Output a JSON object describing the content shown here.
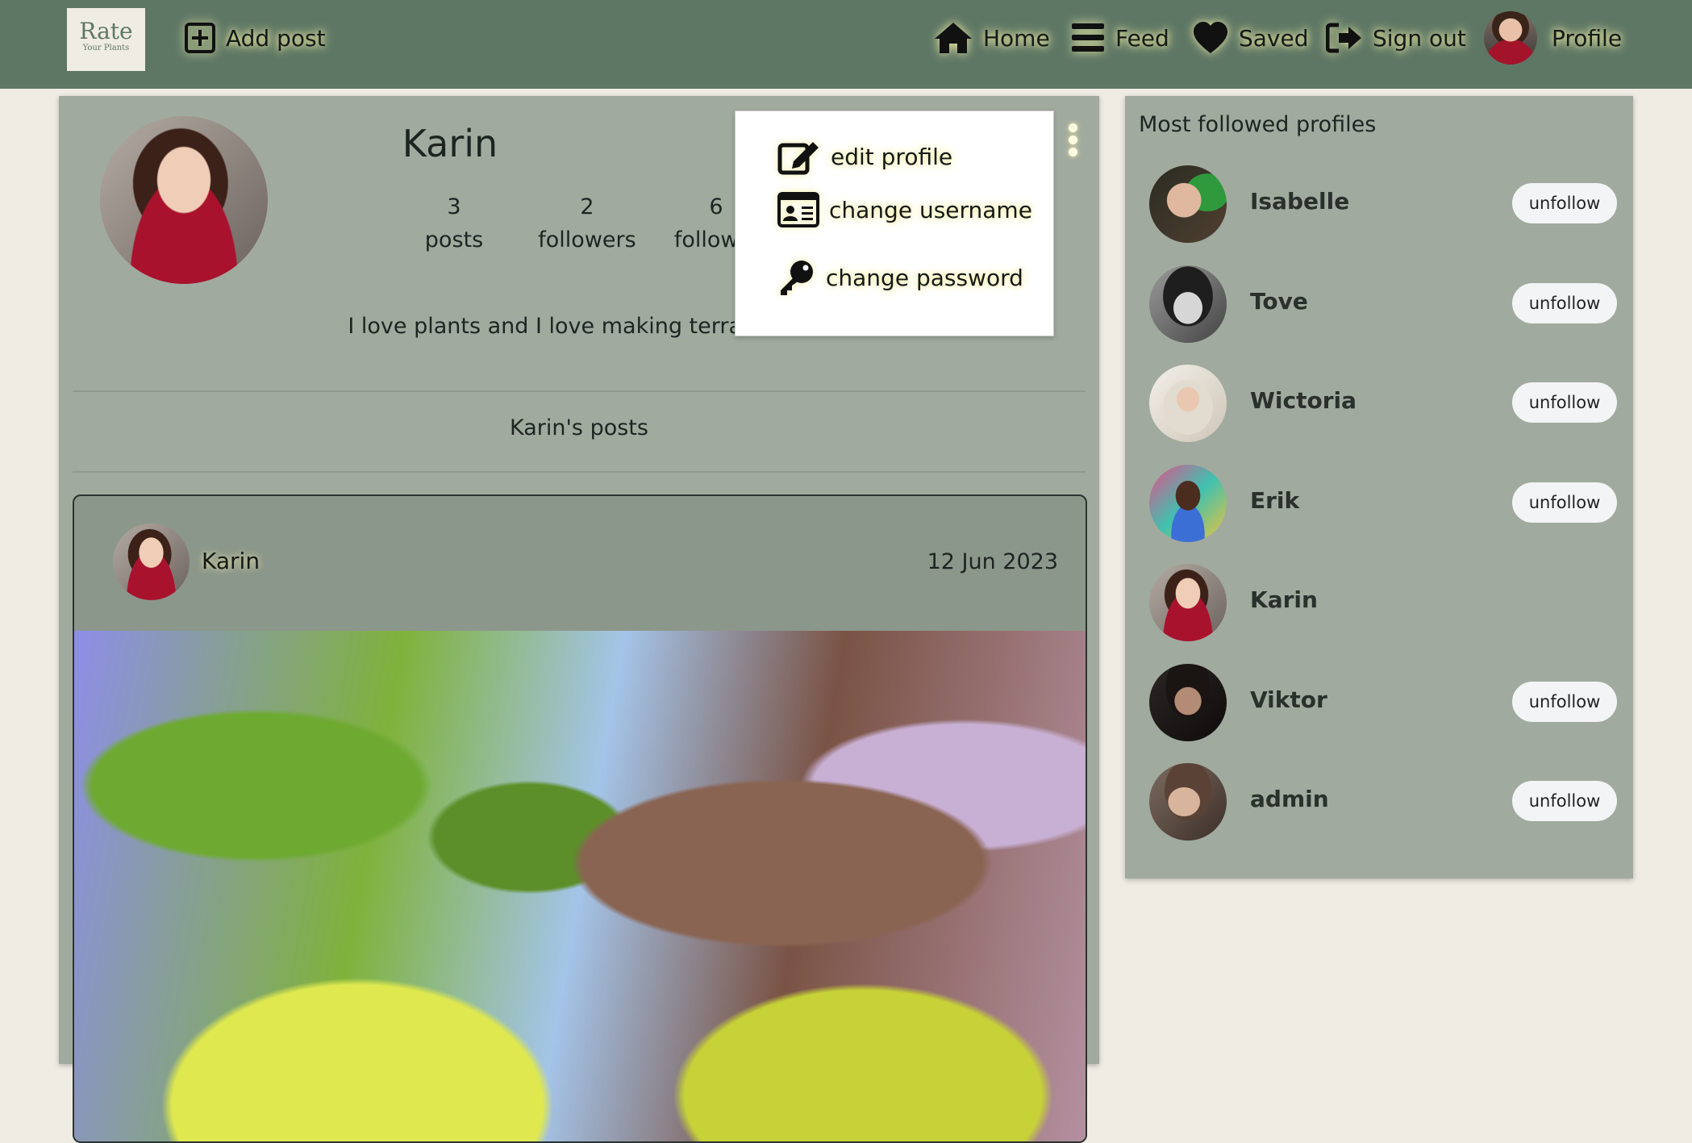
{
  "navbar": {
    "logo_line1": "Rate",
    "logo_line2": "Your Plants",
    "add_post": "Add post",
    "home": "Home",
    "feed": "Feed",
    "saved": "Saved",
    "sign_out": "Sign out",
    "profile": "Profile"
  },
  "profile": {
    "name": "Karin",
    "stats": [
      {
        "value": "3",
        "label": "posts"
      },
      {
        "value": "2",
        "label": "followers"
      },
      {
        "value": "6",
        "label": "followin"
      }
    ],
    "bio": "I love plants and I love making terrariums.",
    "posts_heading": "Karin's posts"
  },
  "dropdown": {
    "edit_profile": "edit profile",
    "change_username": "change username",
    "change_password": "change password"
  },
  "post": {
    "author": "Karin",
    "date": "12 Jun 2023"
  },
  "sidebar": {
    "title": "Most followed profiles",
    "unfollow_label": "unfollow",
    "profiles": [
      {
        "name": "Isabelle"
      },
      {
        "name": "Tove"
      },
      {
        "name": "Wictoria"
      },
      {
        "name": "Erik"
      },
      {
        "name": "Karin"
      },
      {
        "name": "Viktor"
      },
      {
        "name": "admin"
      }
    ]
  },
  "colors": {
    "navbar": "#5e7765",
    "card": "#a1aa9e",
    "page_background": "#efece3",
    "glow": "#f3f0a8"
  }
}
